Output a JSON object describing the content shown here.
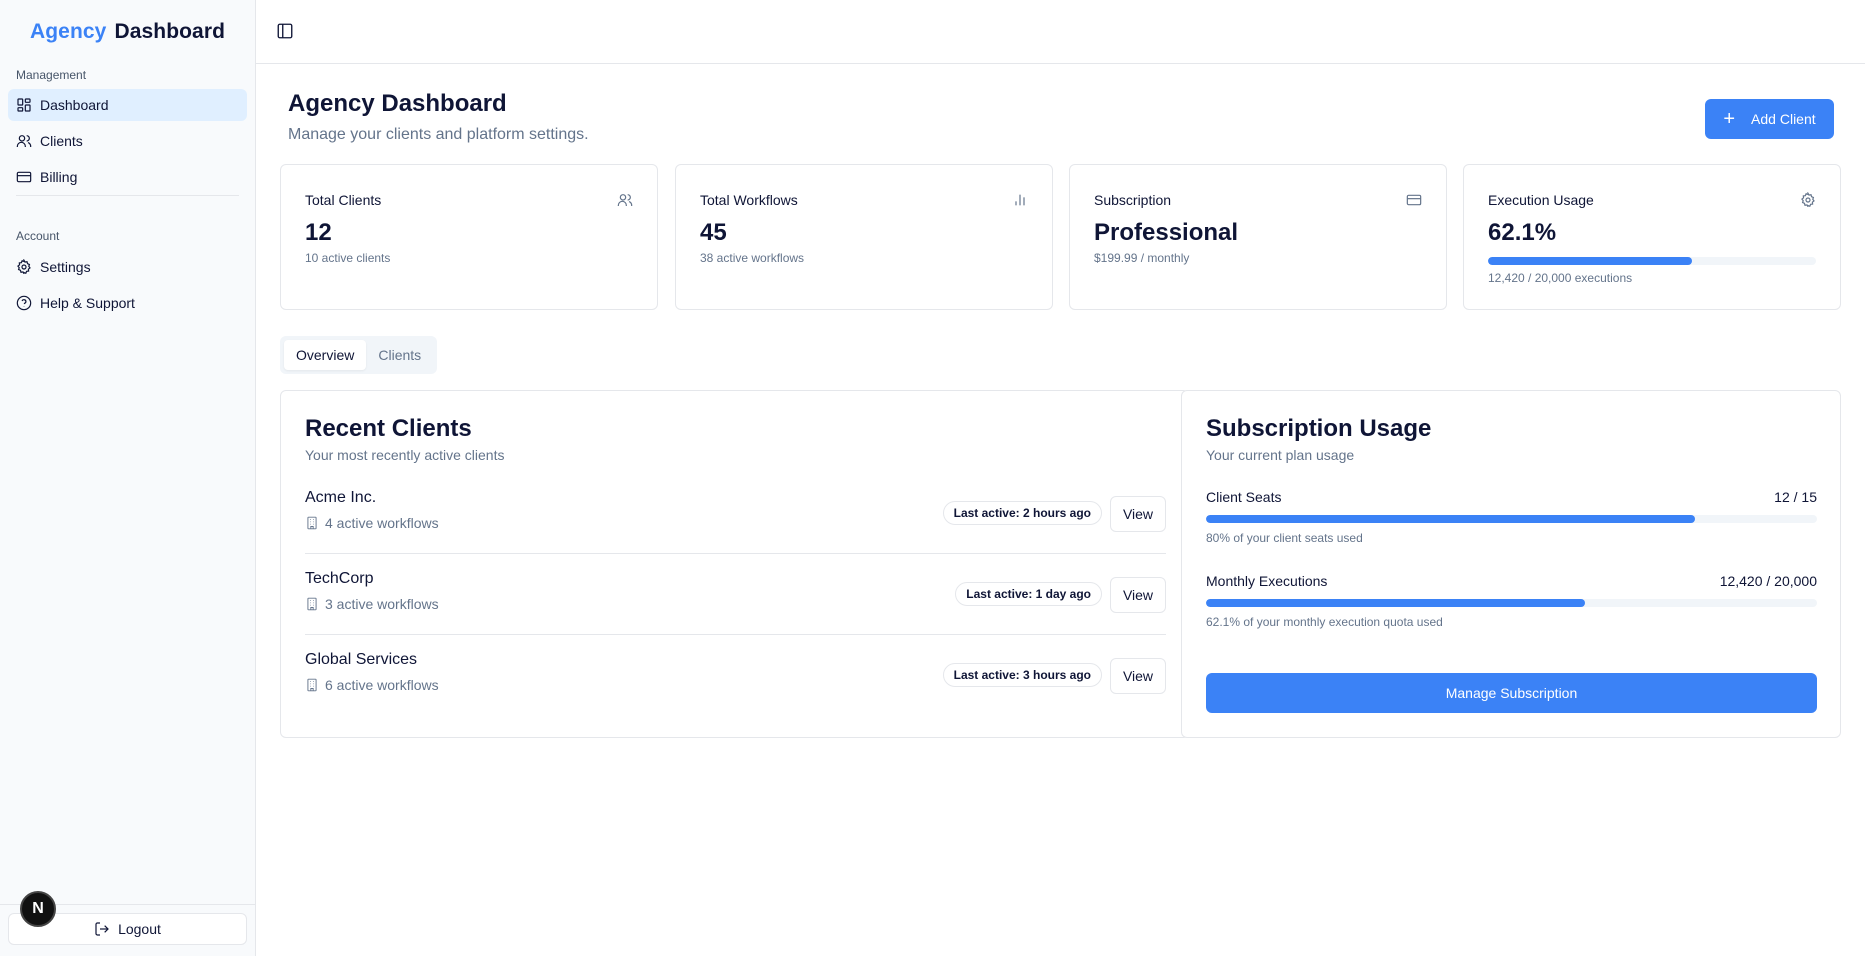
{
  "brand": {
    "part1": "Agency",
    "part2": "Dashboard"
  },
  "sidebar": {
    "management_label": "Management",
    "management_items": [
      {
        "label": "Dashboard",
        "icon": "layout-dashboard-icon"
      },
      {
        "label": "Clients",
        "icon": "users-icon"
      },
      {
        "label": "Billing",
        "icon": "credit-card-icon"
      }
    ],
    "account_label": "Account",
    "account_items": [
      {
        "label": "Settings",
        "icon": "gear-icon"
      },
      {
        "label": "Help & Support",
        "icon": "help-circle-icon"
      }
    ],
    "logout_label": "Logout",
    "badge_letter": "N"
  },
  "header": {
    "title": "Agency Dashboard",
    "subtitle": "Manage your clients and platform settings.",
    "add_client_label": "Add Client"
  },
  "stats": [
    {
      "title": "Total Clients",
      "value": "12",
      "sub": "10 active clients",
      "icon": "users-icon"
    },
    {
      "title": "Total Workflows",
      "value": "45",
      "sub": "38 active workflows",
      "icon": "bar-chart-icon"
    },
    {
      "title": "Subscription",
      "value": "Professional",
      "sub": "$199.99 / monthly",
      "icon": "credit-card-icon"
    },
    {
      "title": "Execution Usage",
      "value": "62.1%",
      "sub": "12,420 / 20,000 executions",
      "icon": "gear-icon",
      "progress": 62.1
    }
  ],
  "tabs": [
    {
      "label": "Overview",
      "active": true
    },
    {
      "label": "Clients",
      "active": false
    }
  ],
  "recent_clients": {
    "title": "Recent Clients",
    "subtitle": "Your most recently active clients",
    "view_label": "View",
    "rows": [
      {
        "name": "Acme Inc.",
        "workflows": "4 active workflows",
        "last_active": "Last active: 2 hours ago"
      },
      {
        "name": "TechCorp",
        "workflows": "3 active workflows",
        "last_active": "Last active: 1 day ago"
      },
      {
        "name": "Global Services",
        "workflows": "6 active workflows",
        "last_active": "Last active: 3 hours ago"
      }
    ]
  },
  "subscription_usage": {
    "title": "Subscription Usage",
    "subtitle": "Your current plan usage",
    "items": [
      {
        "label": "Client Seats",
        "value": "12 / 15",
        "note": "80% of your client seats used",
        "progress": 80
      },
      {
        "label": "Monthly Executions",
        "value": "12,420 / 20,000",
        "note": "62.1% of your monthly execution quota used",
        "progress": 62.1
      }
    ],
    "manage_label": "Manage Subscription"
  },
  "colors": {
    "accent": "#3b82f6",
    "active_nav": "#e0efff"
  }
}
